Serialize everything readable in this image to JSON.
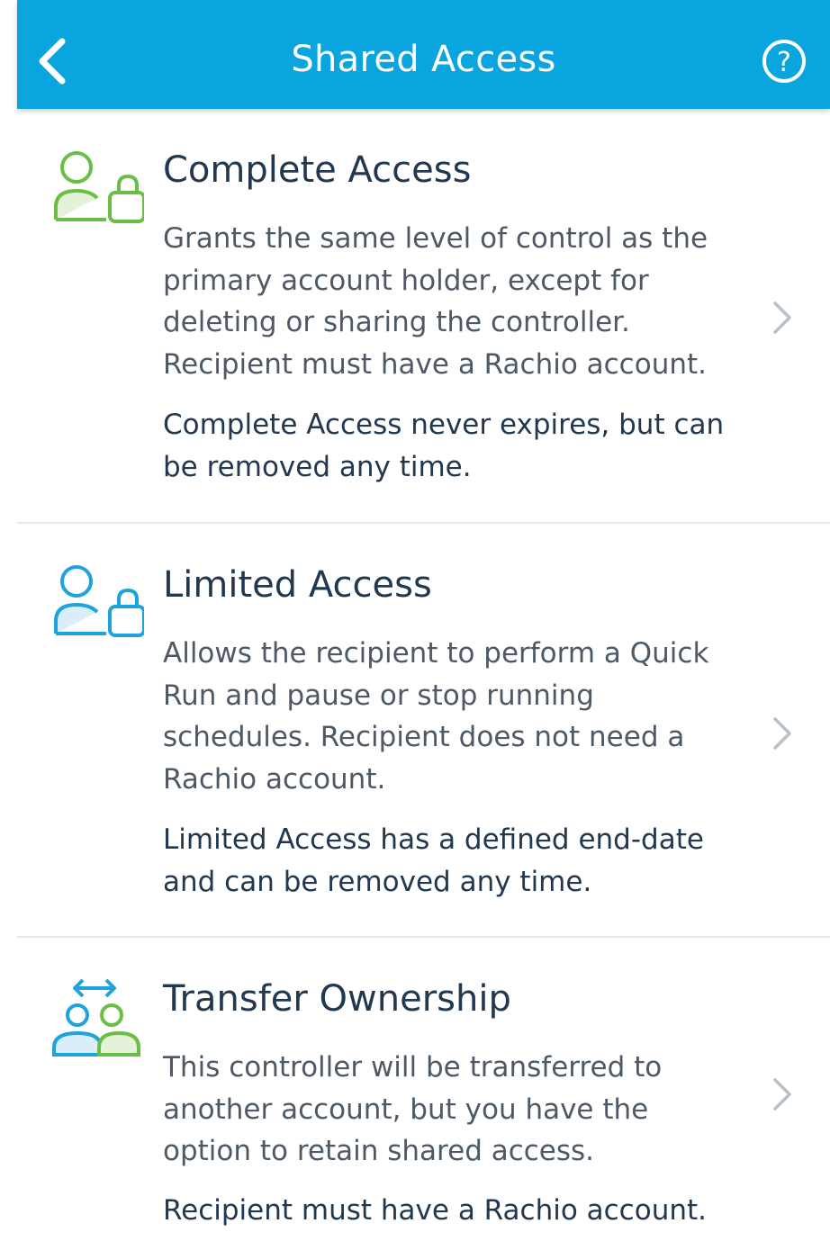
{
  "header": {
    "title": "Shared Access",
    "back_icon": "chevron-left-icon",
    "help_icon": "question-circle-icon",
    "background_color": "#0AA5DF"
  },
  "options": [
    {
      "id": "complete-access",
      "icon": "user-lock-icon",
      "icon_color": "#6BBE45",
      "heading": "Complete Access",
      "description": "Grants the same level of control as the primary account holder, except for deleting or sharing the controller. Recipient must have a Rachio account.",
      "note": "Complete Access never expires, but can be removed any time."
    },
    {
      "id": "limited-access",
      "icon": "user-lock-icon",
      "icon_color": "#1FA3DE",
      "heading": "Limited Access",
      "description": "Allows the recipient to perform a Quick Run and pause or stop running schedules. Recipient does not need a Rachio account.",
      "note": "Limited Access has a defined end-date and can be removed any time."
    },
    {
      "id": "transfer-ownership",
      "icon": "transfer-users-icon",
      "icon_color": "#1FA3DE",
      "heading": "Transfer Ownership",
      "description": "This controller will be transferred to another account, but you have the option to retain shared access.",
      "note": "Recipient must have a Rachio account."
    }
  ],
  "colors": {
    "heading": "#22384F",
    "description": "#4D5A66",
    "divider": "#E6E9EC",
    "chevron": "#B8BFC6"
  }
}
